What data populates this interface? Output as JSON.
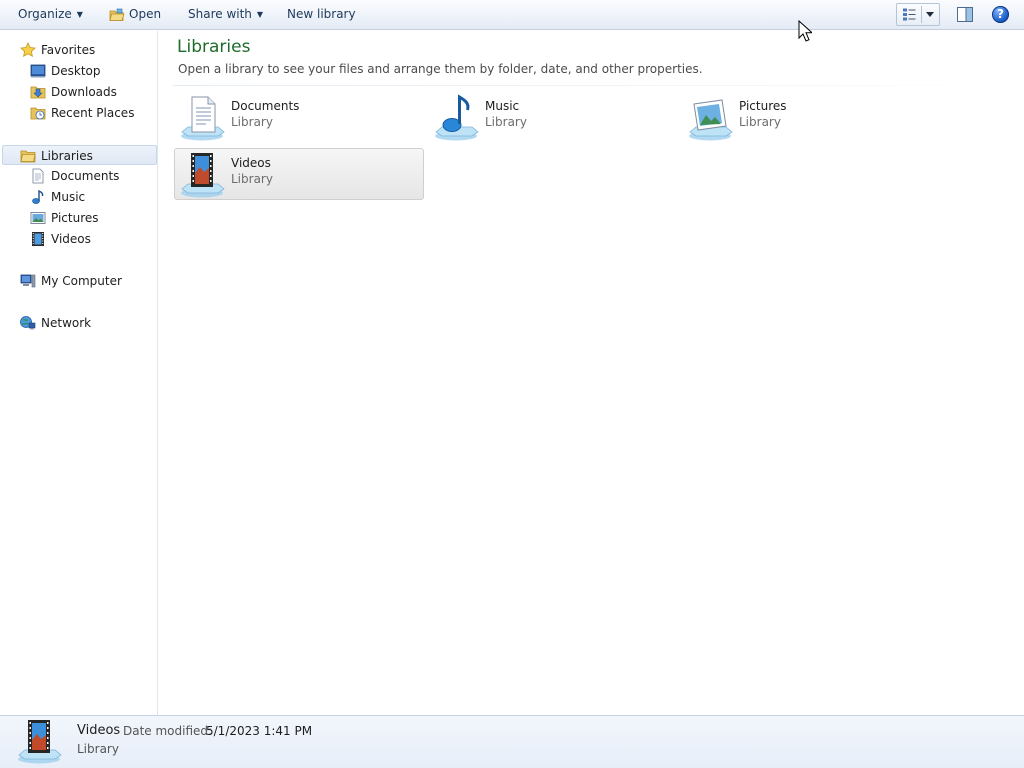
{
  "toolbar": {
    "organize_label": "Organize",
    "open_label": "Open",
    "share_with_label": "Share with",
    "new_library_label": "New library"
  },
  "navigation": {
    "favorites": {
      "label": "Favorites",
      "items": [
        {
          "label": "Desktop"
        },
        {
          "label": "Downloads"
        },
        {
          "label": "Recent Places"
        }
      ]
    },
    "libraries": {
      "label": "Libraries",
      "items": [
        {
          "label": "Documents"
        },
        {
          "label": "Music"
        },
        {
          "label": "Pictures"
        },
        {
          "label": "Videos"
        }
      ]
    },
    "computer": {
      "label": "My Computer"
    },
    "network": {
      "label": "Network"
    }
  },
  "main": {
    "title": "Libraries",
    "subtitle": "Open a library to see your files and arrange them by folder, date, and other properties.",
    "libraries": [
      {
        "name": "Documents",
        "type": "Library",
        "icon": "documents-library-icon"
      },
      {
        "name": "Music",
        "type": "Library",
        "icon": "music-library-icon"
      },
      {
        "name": "Pictures",
        "type": "Library",
        "icon": "pictures-library-icon"
      },
      {
        "name": "Videos",
        "type": "Library",
        "icon": "videos-library-icon",
        "selected": true
      }
    ]
  },
  "details": {
    "name": "Videos",
    "type": "Library",
    "date_label": "Date modified:",
    "date_value": "5/1/2023 1:41 PM"
  },
  "colors": {
    "title_green": "#1e6b2b",
    "command_text": "#1e395b",
    "selection_gray": "#e6e6e6"
  }
}
